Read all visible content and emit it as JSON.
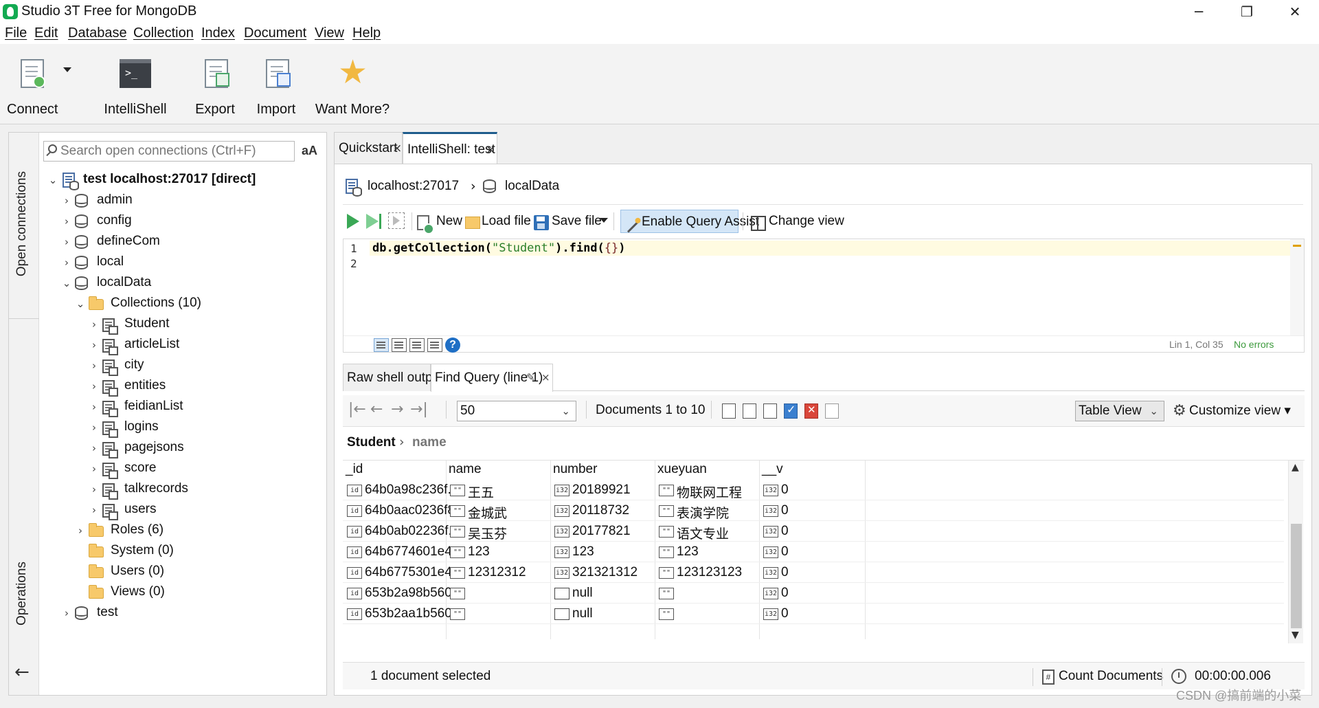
{
  "window": {
    "title": "Studio 3T Free for MongoDB",
    "minimize": "─",
    "maximize": "❐",
    "close": "✕"
  },
  "menu": {
    "items": [
      "File",
      "Edit",
      "Database",
      "Collection",
      "Index",
      "Document",
      "View",
      "Help"
    ]
  },
  "toolbar": {
    "connect": "Connect",
    "intellishell": "IntelliShell",
    "export": "Export",
    "import": "Import",
    "want_more": "Want More?",
    "shell_glyph": ">_"
  },
  "sidebar": {
    "tab_connections": "Open connections",
    "tab_operations": "Operations",
    "back": "←",
    "search_placeholder": "Search open connections (Ctrl+F)",
    "aa_label": "aA",
    "tree": [
      {
        "label": "test localhost:27017 [direct]",
        "icon": "server-icon",
        "caret": "⌄",
        "depth": 0,
        "bold": true
      },
      {
        "label": "admin",
        "icon": "database-icon",
        "caret": "›",
        "depth": 1
      },
      {
        "label": "config",
        "icon": "database-icon",
        "caret": "›",
        "depth": 1
      },
      {
        "label": "defineCom",
        "icon": "database-icon",
        "caret": "›",
        "depth": 1
      },
      {
        "label": "local",
        "icon": "database-icon",
        "caret": "›",
        "depth": 1
      },
      {
        "label": "localData",
        "icon": "database-icon",
        "caret": "⌄",
        "depth": 1
      },
      {
        "label": "Collections (10)",
        "icon": "folder-icon",
        "caret": "⌄",
        "depth": 2
      },
      {
        "label": "Student",
        "icon": "collection-icon",
        "caret": "›",
        "depth": 3
      },
      {
        "label": "articleList",
        "icon": "collection-icon",
        "caret": "›",
        "depth": 3
      },
      {
        "label": "city",
        "icon": "collection-icon",
        "caret": "›",
        "depth": 3
      },
      {
        "label": "entities",
        "icon": "collection-icon",
        "caret": "›",
        "depth": 3
      },
      {
        "label": "feidianList",
        "icon": "collection-icon",
        "caret": "›",
        "depth": 3
      },
      {
        "label": "logins",
        "icon": "collection-icon",
        "caret": "›",
        "depth": 3
      },
      {
        "label": "pagejsons",
        "icon": "collection-icon",
        "caret": "›",
        "depth": 3
      },
      {
        "label": "score",
        "icon": "collection-icon",
        "caret": "›",
        "depth": 3
      },
      {
        "label": "talkrecords",
        "icon": "collection-icon",
        "caret": "›",
        "depth": 3
      },
      {
        "label": "users",
        "icon": "collection-icon",
        "caret": "›",
        "depth": 3
      },
      {
        "label": "Roles (6)",
        "icon": "folder-icon",
        "caret": "›",
        "depth": 2
      },
      {
        "label": "System (0)",
        "icon": "folder-icon",
        "caret": "",
        "depth": 2
      },
      {
        "label": "Users (0)",
        "icon": "folder-icon",
        "caret": "",
        "depth": 2
      },
      {
        "label": "Views (0)",
        "icon": "folder-icon",
        "caret": "",
        "depth": 2
      },
      {
        "label": "test",
        "icon": "database-icon",
        "caret": "›",
        "depth": 1
      }
    ]
  },
  "tabs": [
    {
      "label": "Quickstart",
      "close": "×"
    },
    {
      "label": "IntelliShell: test",
      "close": "×"
    }
  ],
  "shell": {
    "breadcrumb_host": "localhost:27017",
    "breadcrumb_sep": "›",
    "breadcrumb_db": "localData",
    "new": "New",
    "load_file": "Load file",
    "save_file": "Save file",
    "query_assist": "Enable Query Assist",
    "change_view": "Change view",
    "line_numbers": [
      "1",
      "2"
    ],
    "code": {
      "fn1": "db.getCollection(",
      "str": "\"Student\"",
      "fn2": ").find(",
      "brace": "{}",
      "close": ")"
    },
    "help": "?",
    "position": "Lin 1, Col 35",
    "errors": "No errors"
  },
  "results": {
    "tabs": [
      {
        "label": "Raw shell output"
      },
      {
        "label": "Find Query (line 1)",
        "pin": "✎",
        "close": "×"
      }
    ],
    "nav": [
      "|←",
      "←",
      "→",
      "→|"
    ],
    "page_size": "50",
    "page_caret": "⌄",
    "range": "Documents 1 to 10",
    "view_mode": "Table View",
    "customize": "Customize view ▾",
    "gear": "⚙",
    "path_root": "Student",
    "path_sep": "›",
    "path_leaf": "name",
    "columns": [
      "_id",
      "name",
      "number",
      "xueyuan",
      "__v"
    ],
    "rows": [
      {
        "id": "64b0a98c236f...",
        "name": "王五",
        "number": "20189921",
        "xueyuan": "物联网工程",
        "v": "0"
      },
      {
        "id": "64b0aac0236f8...",
        "name": "金城武",
        "number": "20118732",
        "xueyuan": "表演学院",
        "v": "0"
      },
      {
        "id": "64b0ab02236f...",
        "name": "吴玉芬",
        "number": "20177821",
        "xueyuan": "语文专业",
        "v": "0"
      },
      {
        "id": "64b6774601e4...",
        "name": "123",
        "number": "123",
        "xueyuan": "123",
        "v": "0"
      },
      {
        "id": "64b6775301e4...",
        "name": "12312312",
        "number": "321321312",
        "xueyuan": "123123123",
        "v": "0"
      },
      {
        "id": "653b2a98b560...",
        "name": "",
        "number": "null",
        "xueyuan": "",
        "v": "0"
      },
      {
        "id": "653b2aa1b560...",
        "name": "",
        "number": "null",
        "xueyuan": "",
        "v": "0"
      }
    ],
    "type_glyphs": {
      "id": "id",
      "str": "\"\"",
      "num": "i32"
    },
    "scroll_up": "▲",
    "scroll_down": "▼",
    "status_selected": "1 document selected",
    "count_documents": "Count Documents",
    "count_glyph": "#",
    "elapsed": "00:00:00.006"
  },
  "watermark": "CSDN @搞前端的小菜"
}
